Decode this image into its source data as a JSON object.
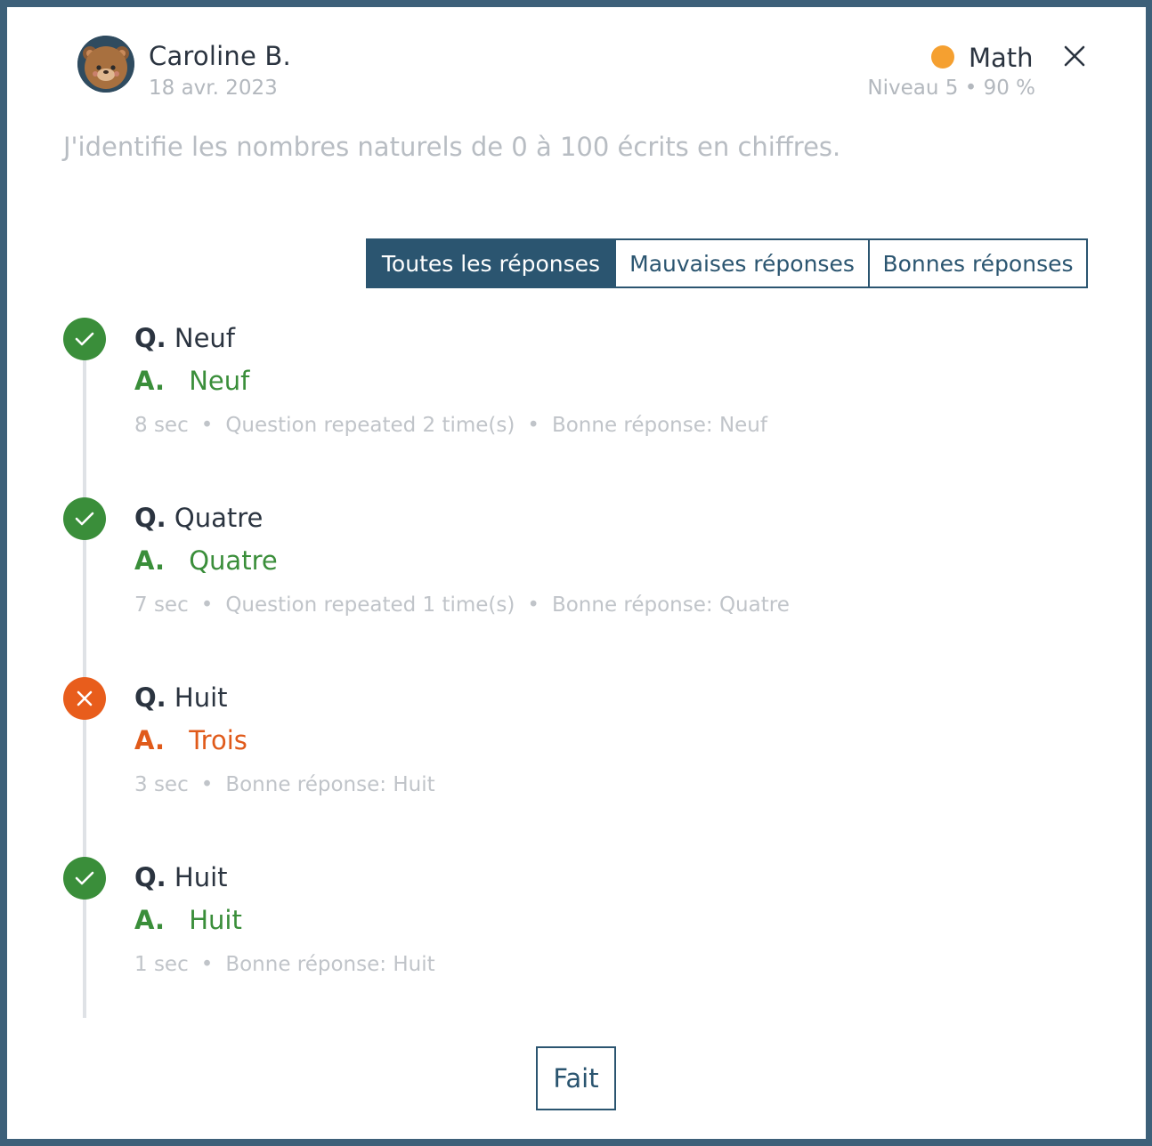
{
  "student": {
    "name": "Caroline B.",
    "date": "18 avr. 2023"
  },
  "subject": {
    "name": "Math",
    "level": "Niveau 5 • 90 %",
    "dot_color": "#f5a030"
  },
  "objective": "J'identifie les nombres naturels de 0 à 100 écrits en chiffres.",
  "tabs": [
    {
      "label": "Toutes les réponses",
      "active": true
    },
    {
      "label": "Mauvaises réponses",
      "active": false
    },
    {
      "label": "Bonnes réponses",
      "active": false
    }
  ],
  "labels": {
    "question_prefix": "Q.",
    "answer_prefix": "A.",
    "done": "Fait"
  },
  "answers": [
    {
      "question": "Neuf",
      "answer": "Neuf",
      "correct": true,
      "time": "8 sec",
      "repeated": "Question repeated 2 time(s)",
      "expected": "Bonne réponse: Neuf"
    },
    {
      "question": "Quatre",
      "answer": "Quatre",
      "correct": true,
      "time": "7 sec",
      "repeated": "Question repeated 1 time(s)",
      "expected": "Bonne réponse: Quatre"
    },
    {
      "question": "Huit",
      "answer": "Trois",
      "correct": false,
      "time": "3 sec",
      "expected": "Bonne réponse: Huit"
    },
    {
      "question": "Huit",
      "answer": "Huit",
      "correct": true,
      "time": "1 sec",
      "expected": "Bonne réponse: Huit"
    }
  ],
  "colors": {
    "correct": "#3a8e3a",
    "incorrect": "#e85d1c",
    "primary": "#2b5570",
    "backdrop": "#3d6079"
  },
  "icons": {
    "close": "close-icon",
    "correct": "checkmark-icon",
    "incorrect": "cross-icon",
    "avatar": "bear-avatar"
  }
}
